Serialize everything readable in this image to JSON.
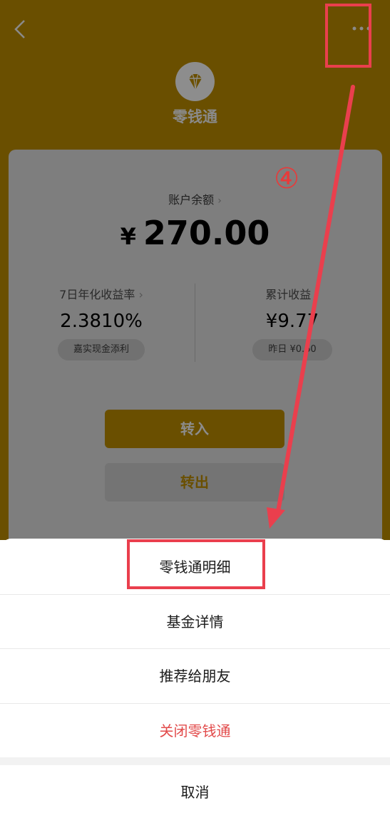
{
  "header": {
    "back_icon": "chevron-left-icon",
    "more_icon": "more-dots-icon"
  },
  "app": {
    "title": "零钱通",
    "logo_icon": "diamond-icon"
  },
  "balance": {
    "label": "账户余额",
    "currency": "¥",
    "amount": "270.00"
  },
  "stats": {
    "yield_label": "7日年化收益率",
    "yield_value": "2.3810%",
    "yield_chip": "嘉实现金添利",
    "income_label": "累计收益",
    "income_value": "¥9.77",
    "income_chip": "昨日 ¥0.60"
  },
  "actions": {
    "deposit_label": "转入",
    "withdraw_label": "转出"
  },
  "annotation": {
    "step": "④"
  },
  "sheet": {
    "items": [
      "零钱通明细",
      "基金详情",
      "推荐给朋友",
      "关闭零钱通"
    ],
    "cancel_label": "取消"
  },
  "colors": {
    "overlay": "#6a4f00",
    "highlight": "#ea3f4d",
    "danger": "#e24a4a"
  }
}
